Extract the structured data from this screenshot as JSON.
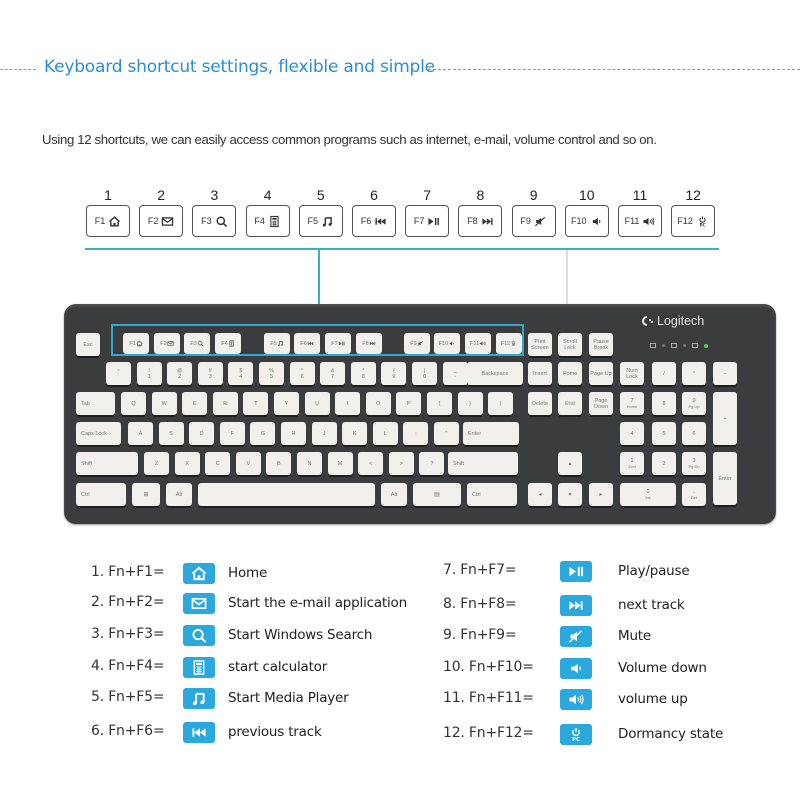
{
  "header": {
    "title": "Keyboard shortcut settings, flexible and simple",
    "intro": "Using 12 shortcuts, we can easily access common programs such as internet, e-mail, volume control and so on."
  },
  "colors": {
    "accent": "#2a8fd6",
    "icon_bg": "#2ba8dc",
    "highlight_line": "#3ab0c8",
    "keyboard_body": "#3b3c3e",
    "keycap": "#f1f0ec"
  },
  "fkeys": [
    {
      "num": "1",
      "label": "F1",
      "icon": "home-icon"
    },
    {
      "num": "2",
      "label": "F2",
      "icon": "mail-icon"
    },
    {
      "num": "3",
      "label": "F3",
      "icon": "search-icon"
    },
    {
      "num": "4",
      "label": "F4",
      "icon": "calculator-icon"
    },
    {
      "num": "5",
      "label": "F5",
      "icon": "music-note-icon"
    },
    {
      "num": "6",
      "label": "F6",
      "icon": "previous-track-icon"
    },
    {
      "num": "7",
      "label": "F7",
      "icon": "play-pause-icon"
    },
    {
      "num": "8",
      "label": "F8",
      "icon": "next-track-icon"
    },
    {
      "num": "9",
      "label": "F9",
      "icon": "mute-icon"
    },
    {
      "num": "10",
      "label": "F10",
      "icon": "volume-down-icon"
    },
    {
      "num": "11",
      "label": "F11",
      "icon": "volume-up-icon"
    },
    {
      "num": "12",
      "label": "F12",
      "icon": "power-pc-icon"
    }
  ],
  "keyboard": {
    "brand": "Logitech",
    "keys": {
      "esc": "Esc",
      "prtsc": "Print Screen",
      "scroll": "Scroll Lock",
      "pause": "Pause Break",
      "backspace": "Backspace",
      "insert": "Insert",
      "home": "Home",
      "pgup": "Page Up",
      "numlock": "Num Lock",
      "tab": "Tab",
      "delete": "Delete",
      "end": "End",
      "pgdn": "Page Down",
      "caps": "Caps Lock",
      "enter": "Enter",
      "shift": "Shift",
      "ctrl": "Ctrl",
      "alt": "Alt",
      "row1": [
        [
          "~",
          "`"
        ],
        [
          "!",
          "1"
        ],
        [
          "@",
          "2"
        ],
        [
          "#",
          "3"
        ],
        [
          "$",
          "4"
        ],
        [
          "%",
          "5"
        ],
        [
          "^",
          "6"
        ],
        [
          "&",
          "7"
        ],
        [
          "*",
          "8"
        ],
        [
          "(",
          "9"
        ],
        [
          ")",
          "0"
        ],
        [
          "_",
          "-"
        ],
        [
          "+",
          "="
        ]
      ],
      "row2": [
        "Q",
        "W",
        "E",
        "R",
        "T",
        "Y",
        "U",
        "I",
        "O",
        "P",
        "{",
        "}",
        "|"
      ],
      "row3": [
        "A",
        "S",
        "D",
        "F",
        "G",
        "H",
        "J",
        "K",
        "L",
        ":",
        "\""
      ],
      "row4": [
        "Z",
        "X",
        "C",
        "V",
        "B",
        "N",
        "M",
        "<",
        ">",
        "?"
      ],
      "numpad": {
        "slash": "/",
        "star": "*",
        "minus": "−",
        "plus": "+",
        "n7": "7",
        "n8": "8",
        "n9": "9",
        "n4": "4",
        "n5": "5",
        "n6": "6",
        "n1": "1",
        "n2": "2",
        "n3": "3",
        "n0": "0",
        "dot": ".",
        "n7sub": "Home",
        "n9sub": "Pg Up",
        "n1sub": "End",
        "n3sub": "Pg Dn",
        "n0sub": "Ins",
        "dotsub": "Del"
      }
    }
  },
  "shortcuts": [
    {
      "combo": "1. Fn+F1=",
      "icon": "home-icon",
      "desc": "Home"
    },
    {
      "combo": "2. Fn+F2=",
      "icon": "mail-icon",
      "desc": "Start the e-mail application"
    },
    {
      "combo": "3. Fn+F3=",
      "icon": "search-icon",
      "desc": "Start Windows Search"
    },
    {
      "combo": "4. Fn+F4=",
      "icon": "calculator-icon",
      "desc": "start calculator"
    },
    {
      "combo": "5. Fn+F5=",
      "icon": "music-note-icon",
      "desc": "Start Media Player"
    },
    {
      "combo": "6. Fn+F6=",
      "icon": "previous-track-icon",
      "desc": "previous track"
    },
    {
      "combo": "7. Fn+F7=",
      "icon": "play-pause-icon",
      "desc": "Play/pause"
    },
    {
      "combo": "8. Fn+F8=",
      "icon": "next-track-icon",
      "desc": "next track"
    },
    {
      "combo": "9. Fn+F9=",
      "icon": "mute-icon",
      "desc": "Mute"
    },
    {
      "combo": "10. Fn+F10=",
      "icon": "volume-down-icon",
      "desc": "Volume down"
    },
    {
      "combo": "11. Fn+F11=",
      "icon": "volume-up-icon",
      "desc": "volume up"
    },
    {
      "combo": "12. Fn+F12=",
      "icon": "power-pc-icon",
      "desc": "Dormancy state"
    }
  ]
}
